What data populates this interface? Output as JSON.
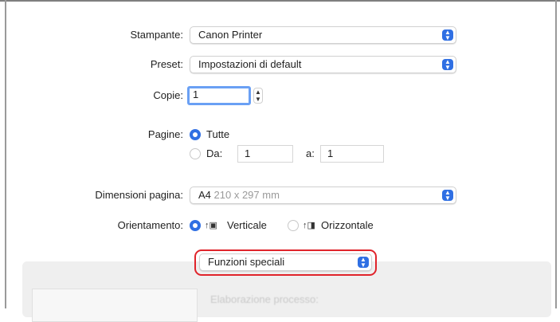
{
  "printer": {
    "label": "Stampante:",
    "value": "Canon Printer"
  },
  "preset": {
    "label": "Preset:",
    "value": "Impostazioni di default"
  },
  "copies": {
    "label": "Copie:",
    "value": "1"
  },
  "pages": {
    "label": "Pagine:",
    "all_label": "Tutte",
    "from_label": "Da:",
    "from_value": "1",
    "to_label": "a:",
    "to_value": "1"
  },
  "paper_size": {
    "label": "Dimensioni pagina:",
    "value": "A4",
    "detail": "210 x 297 mm"
  },
  "orientation": {
    "label": "Orientamento:",
    "portrait": "Verticale",
    "landscape": "Orizzontale"
  },
  "special_functions": {
    "value": "Funzioni speciali"
  },
  "section_text": "Elaborazione processo:",
  "colors": {
    "accent": "#2f6fe3",
    "highlight": "#e0242b",
    "focus": "#6aa0f4"
  },
  "icons": {
    "stepper": "updown-chevron-icon",
    "portrait": "portrait-page-icon",
    "landscape": "landscape-page-icon"
  }
}
